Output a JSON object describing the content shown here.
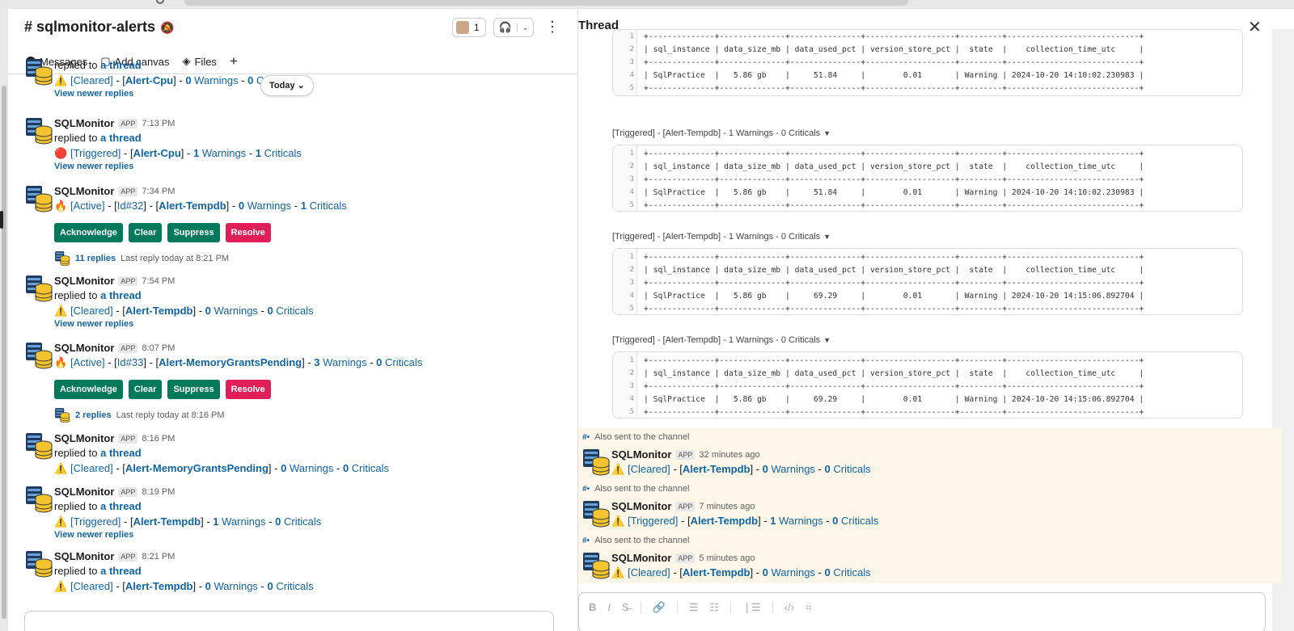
{
  "channel": {
    "name": "sqlmonitor-alerts",
    "member_count": "1",
    "tabs": [
      {
        "label": "Messages",
        "icon": "message-icon"
      },
      {
        "label": "Add canvas",
        "icon": "canvas-icon"
      },
      {
        "label": "Files",
        "icon": "files-icon"
      }
    ],
    "today_label": "Today",
    "messages": [
      {
        "kind": "partial",
        "reply_prefix": "replied to",
        "reply_link": "a thread",
        "emoji": "⚠️",
        "status": "[Cleared]",
        "alert": "Alert-Cpu",
        "warnings": "0",
        "criticals": "0",
        "newer": "View newer replies"
      },
      {
        "user": "SQLMonitor",
        "app": "APP",
        "time": "7:13 PM",
        "reply_prefix": "replied to",
        "reply_link": "a thread",
        "emoji": "🔴",
        "status": "[Triggered]",
        "alert": "Alert-Cpu",
        "warnings": "1",
        "criticals": "1",
        "newer": "View newer replies"
      },
      {
        "user": "SQLMonitor",
        "app": "APP",
        "time": "7:34 PM",
        "emoji": "🔥",
        "status": "[Active]",
        "id": "Id#32",
        "alert": "Alert-Tempdb",
        "warnings": "0",
        "criticals": "1",
        "replies": "11 replies",
        "last_reply": "Last reply today at 8:21 PM"
      },
      {
        "user": "SQLMonitor",
        "app": "APP",
        "time": "7:54 PM",
        "reply_prefix": "replied to",
        "reply_link": "a thread",
        "emoji": "⚠️",
        "status": "[Cleared]",
        "alert": "Alert-Tempdb",
        "warnings": "0",
        "criticals": "0",
        "newer": "View newer replies"
      },
      {
        "user": "SQLMonitor",
        "app": "APP",
        "time": "8:07 PM",
        "emoji": "🔥",
        "status": "[Active]",
        "id": "Id#33",
        "alert": "Alert-MemoryGrantsPending",
        "warnings": "3",
        "criticals": "0",
        "replies": "2 replies",
        "last_reply": "Last reply today at 8:16 PM"
      },
      {
        "user": "SQLMonitor",
        "app": "APP",
        "time": "8:16 PM",
        "reply_prefix": "replied to",
        "reply_link": "a thread",
        "emoji": "⚠️",
        "status": "[Cleared]",
        "alert": "Alert-MemoryGrantsPending",
        "warnings": "0",
        "criticals": "0"
      },
      {
        "user": "SQLMonitor",
        "app": "APP",
        "time": "8:19 PM",
        "reply_prefix": "replied to",
        "reply_link": "a thread",
        "emoji": "⚠️",
        "status": "[Triggered]",
        "alert": "Alert-Tempdb",
        "warnings": "1",
        "criticals": "0",
        "newer": "View newer replies"
      },
      {
        "user": "SQLMonitor",
        "app": "APP",
        "time": "8:21 PM",
        "reply_prefix": "replied to",
        "reply_link": "a thread",
        "emoji": "⚠️",
        "status": "[Cleared]",
        "alert": "Alert-Tempdb",
        "warnings": "0",
        "criticals": "0"
      }
    ],
    "buttons": {
      "acknowledge": "Acknowledge",
      "clear": "Clear",
      "suppress": "Suppress",
      "resolve": "Resolve"
    },
    "words": {
      "warnings": "Warnings",
      "criticals": "Criticals"
    }
  },
  "thread": {
    "title": "Thread",
    "snippet_label": "[Triggered] - [Alert-Tempdb] - 1 Warnings - 0 Criticals",
    "blocks": [
      {
        "lines": [
          "+--------------+--------------+---------------+-------------------+---------+----------------------------+",
          "| sql_instance | data_size_mb | data_used_pct | version_store_pct |  state  |    collection_time_utc     |",
          "+--------------+--------------+---------------+-------------------+---------+----------------------------+",
          "| SqlPractice  |   5.86 gb    |     51.84     |        0.01       | Warning | 2024-10-20 14:10:02.230983 |",
          "+--------------+--------------+---------------+-------------------+---------+----------------------------+"
        ]
      },
      {
        "lines": [
          "+--------------+--------------+---------------+-------------------+---------+----------------------------+",
          "| sql_instance | data_size_mb | data_used_pct | version_store_pct |  state  |    collection_time_utc     |",
          "+--------------+--------------+---------------+-------------------+---------+----------------------------+",
          "| SqlPractice  |   5.86 gb    |     51.84     |        0.01       | Warning | 2024-10-20 14:10:02.230983 |",
          "+--------------+--------------+---------------+-------------------+---------+----------------------------+"
        ]
      },
      {
        "lines": [
          "+--------------+--------------+---------------+-------------------+---------+----------------------------+",
          "| sql_instance | data_size_mb | data_used_pct | version_store_pct |  state  |    collection_time_utc     |",
          "+--------------+--------------+---------------+-------------------+---------+----------------------------+",
          "| SqlPractice  |   5.86 gb    |     69.29     |        0.01       | Warning | 2024-10-20 14:15:06.892704 |",
          "+--------------+--------------+---------------+-------------------+---------+----------------------------+"
        ]
      },
      {
        "lines": [
          "+--------------+--------------+---------------+-------------------+---------+----------------------------+",
          "| sql_instance | data_size_mb | data_used_pct | version_store_pct |  state  |    collection_time_utc     |",
          "+--------------+--------------+---------------+-------------------+---------+----------------------------+",
          "| SqlPractice  |   5.86 gb    |     69.29     |        0.01       | Warning | 2024-10-20 14:15:06.892704 |",
          "+--------------+--------------+---------------+-------------------+---------+----------------------------+"
        ]
      }
    ],
    "also_label": "Also sent to the channel",
    "also_messages": [
      {
        "user": "SQLMonitor",
        "app": "APP",
        "time": "32 minutes ago",
        "emoji": "⚠️",
        "status": "[Cleared]",
        "alert": "Alert-Tempdb",
        "warnings": "0",
        "criticals": "0"
      },
      {
        "user": "SQLMonitor",
        "app": "APP",
        "time": "7 minutes ago",
        "emoji": "⚠️",
        "status": "[Triggered]",
        "alert": "Alert-Tempdb",
        "warnings": "1",
        "criticals": "0"
      },
      {
        "user": "SQLMonitor",
        "app": "APP",
        "time": "5 minutes ago",
        "emoji": "⚠️",
        "status": "[Cleared]",
        "alert": "Alert-Tempdb",
        "warnings": "0",
        "criticals": "0"
      }
    ],
    "format_icons": [
      "bold-icon",
      "italic-icon",
      "strikethrough-icon",
      "link-icon",
      "ordered-list-icon",
      "bullet-list-icon",
      "blockquote-icon",
      "code-icon",
      "code-block-icon"
    ]
  }
}
